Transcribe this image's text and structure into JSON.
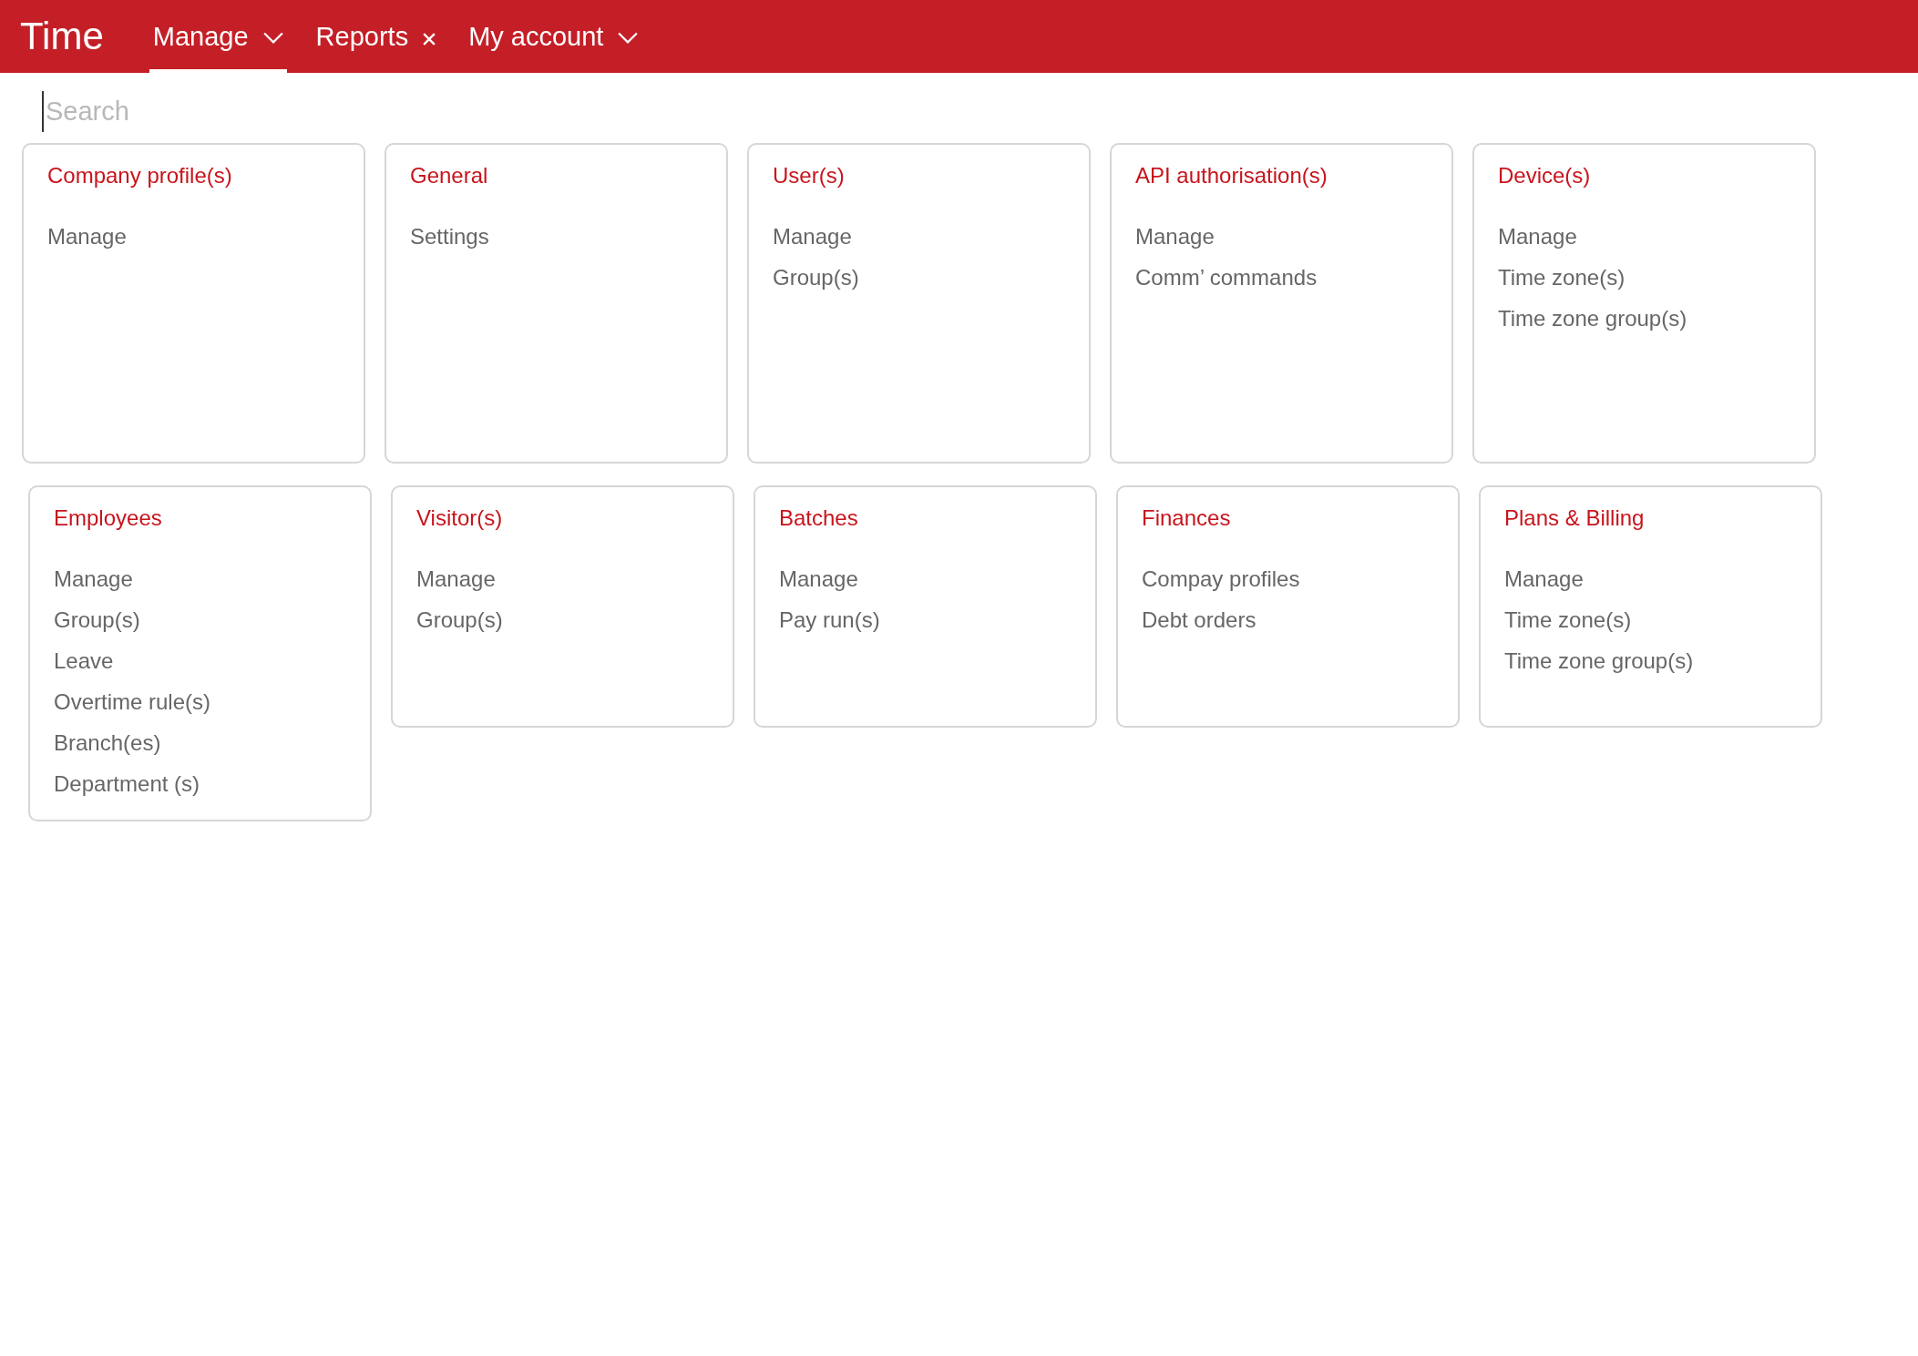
{
  "app_title": "Time",
  "nav": [
    {
      "label": "Manage",
      "kind": "dropdown",
      "selected": true
    },
    {
      "label": "Reports",
      "kind": "closable",
      "selected": false
    },
    {
      "label": "My account",
      "kind": "dropdown",
      "selected": false
    }
  ],
  "search": {
    "placeholder": "Search"
  },
  "card_rows": [
    [
      {
        "title": "Company profile(s)",
        "items": [
          "Manage"
        ]
      },
      {
        "title": "General",
        "items": [
          "Settings"
        ]
      },
      {
        "title": "User(s)",
        "items": [
          "Manage",
          "Group(s)"
        ]
      },
      {
        "title": "API authorisation(s)",
        "items": [
          "Manage",
          "Comm’ commands"
        ]
      },
      {
        "title": "Device(s)",
        "items": [
          "Manage",
          "Time zone(s)",
          "Time zone group(s)"
        ]
      }
    ],
    [
      {
        "title": "Employees",
        "items": [
          "Manage",
          "Group(s)",
          "Leave",
          "Overtime rule(s)",
          "Branch(es)",
          "Department (s)"
        ]
      },
      {
        "title": "Visitor(s)",
        "items": [
          "Manage",
          "Group(s)"
        ]
      },
      {
        "title": "Batches",
        "items": [
          "Manage",
          "Pay run(s)"
        ]
      },
      {
        "title": "Finances",
        "items": [
          "Compay profiles",
          "Debt orders"
        ]
      },
      {
        "title": "Plans & Billing",
        "items": [
          "Manage",
          "Time zone(s)",
          "Time zone group(s)"
        ]
      }
    ]
  ]
}
